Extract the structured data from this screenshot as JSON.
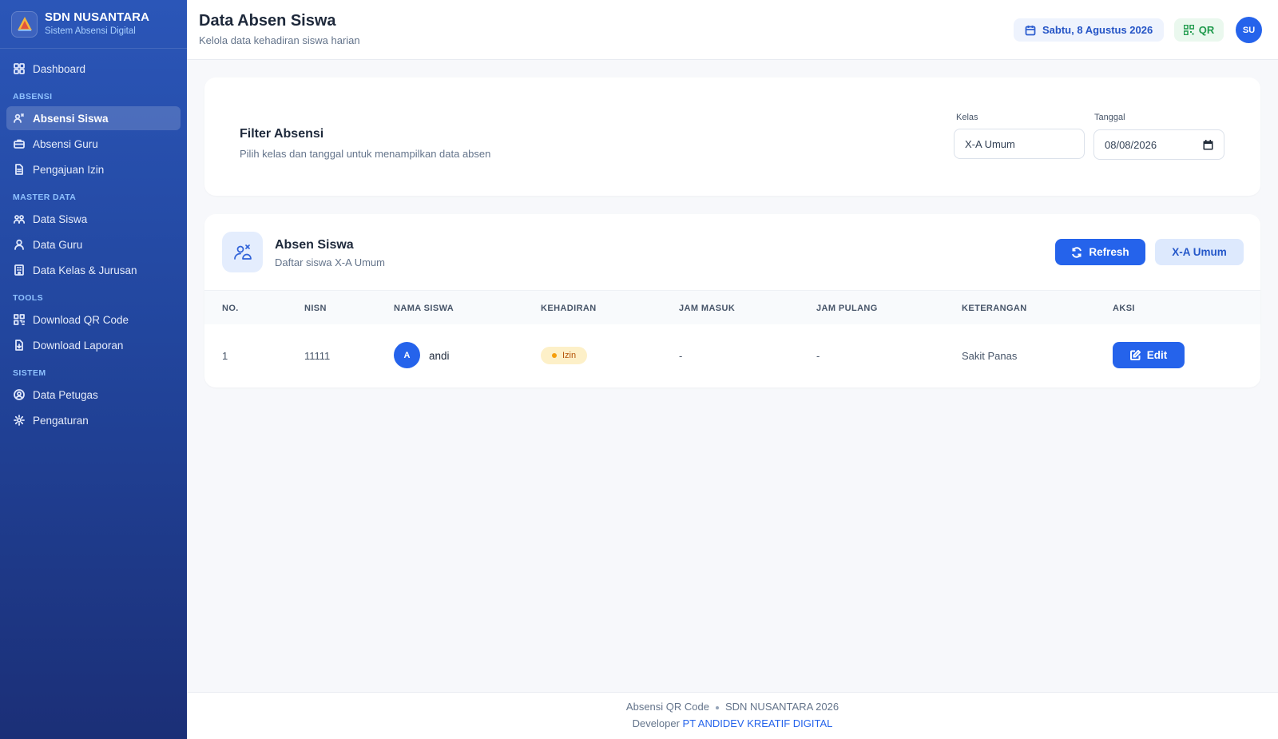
{
  "brand": {
    "title": "SDN NUSANTARA",
    "subtitle": "Sistem Absensi Digital"
  },
  "sidebar": {
    "top": {
      "label": "Dashboard",
      "icon": "grid-icon"
    },
    "sections": [
      {
        "title": "ABSENSI",
        "items": [
          {
            "label": "Absensi Siswa",
            "icon": "users-scan-icon",
            "active": true
          },
          {
            "label": "Absensi Guru",
            "icon": "briefcase-icon"
          },
          {
            "label": "Pengajuan Izin",
            "icon": "document-icon"
          }
        ]
      },
      {
        "title": "MASTER DATA",
        "items": [
          {
            "label": "Data Siswa",
            "icon": "students-icon"
          },
          {
            "label": "Data Guru",
            "icon": "user-icon"
          },
          {
            "label": "Data Kelas & Jurusan",
            "icon": "building-icon"
          }
        ]
      },
      {
        "title": "TOOLS",
        "items": [
          {
            "label": "Download QR Code",
            "icon": "qr-icon"
          },
          {
            "label": "Download Laporan",
            "icon": "report-icon"
          }
        ]
      },
      {
        "title": "SISTEM",
        "items": [
          {
            "label": "Data Petugas",
            "icon": "user-circle-icon"
          },
          {
            "label": "Pengaturan",
            "icon": "gear-icon"
          }
        ]
      }
    ]
  },
  "header": {
    "title": "Data Absen Siswa",
    "subtitle": "Kelola data kehadiran siswa harian",
    "date": "Sabtu, 8 Agustus 2026",
    "qr_label": "QR",
    "avatar_initials": "SU"
  },
  "filter": {
    "title": "Filter Absensi",
    "subtitle": "Pilih kelas dan tanggal untuk menampilkan data absen",
    "kelas_label": "Kelas",
    "kelas_value": "X-A Umum",
    "tanggal_label": "Tanggal",
    "tanggal_value": "08/08/2026"
  },
  "table_card": {
    "title": "Absen Siswa",
    "subtitle": "Daftar siswa X-A Umum",
    "refresh_label": "Refresh",
    "class_label": "X-A Umum",
    "columns": [
      "NO.",
      "NISN",
      "NAMA SISWA",
      "KEHADIRAN",
      "JAM MASUK",
      "JAM PULANG",
      "KETERANGAN",
      "AKSI"
    ],
    "rows": [
      {
        "no": "1",
        "nisn": "11111",
        "avatar": "A",
        "nama": "andi",
        "kehadiran": "Izin",
        "jam_masuk": "-",
        "jam_pulang": "-",
        "keterangan": "Sakit Panas",
        "aksi": "Edit"
      }
    ]
  },
  "footer": {
    "left": "Absensi QR Code",
    "right": "SDN NUSANTARA 2026",
    "developer_prefix": "Developer",
    "developer_name": "PT ANDIDEV KREATIF DIGITAL"
  },
  "colors": {
    "primary": "#2563eb",
    "sidebar": "#22469e",
    "izin_badge": "#fdf0c8",
    "qr_green": "#1f9a4c"
  }
}
